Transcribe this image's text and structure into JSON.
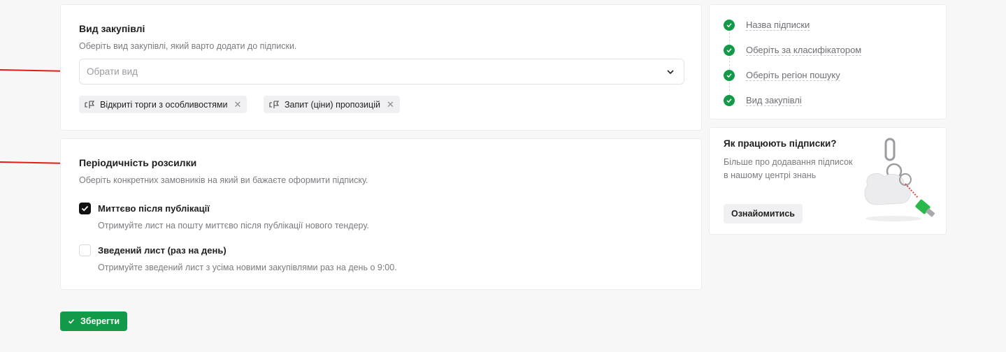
{
  "procurement": {
    "title": "Вид закупівлі",
    "subtitle": "Оберіть вид закупівлі, який варто додати до підписки.",
    "select_placeholder": "Обрати вид",
    "tags": [
      {
        "label": "Відкриті торги з особливостями"
      },
      {
        "label": "Запит (ціни) пропозицій"
      }
    ]
  },
  "frequency": {
    "title": "Періодичність розсилки",
    "subtitle": "Оберіть конкретних замовників на який ви бажаєте оформити підписку.",
    "options": [
      {
        "label": "Миттєво після публікації",
        "description": "Отримуйте лист на пошту миттєво після публікації нового тендеру.",
        "checked": true
      },
      {
        "label": "Зведений лист (раз на день)",
        "description": "Отримуйте зведений лист з усіма новими закупівлями раз на день о 9:00.",
        "checked": false
      }
    ]
  },
  "steps": [
    {
      "label": "Назва підписки",
      "done": true
    },
    {
      "label": "Оберіть за класифікатором",
      "done": true
    },
    {
      "label": "Оберіть регіон пошуку",
      "done": true
    },
    {
      "label": "Вид закупівлі",
      "done": true
    }
  ],
  "help": {
    "title": "Як працюють підписки?",
    "text": "Більше про додавання підписок в нашому центрі знань",
    "button": "Ознайомитись"
  },
  "save_label": "Зберегти",
  "colors": {
    "accent": "#129a48",
    "annotation_arrow": "#e31b1b"
  },
  "icons": {
    "tag": "tender-type-icon",
    "remove": "close-icon",
    "step": "check-circle-icon",
    "select": "chevron-down-icon"
  }
}
